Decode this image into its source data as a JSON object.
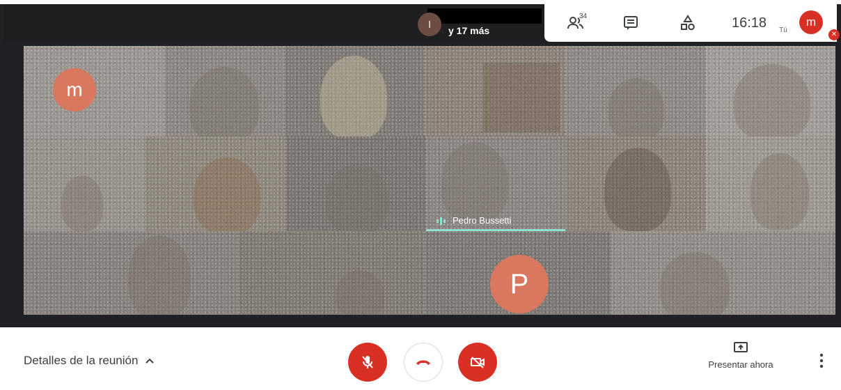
{
  "top_bar": {
    "pinned_avatar_initial": "l",
    "more_participants_label": "y 17 más",
    "people_count": "34",
    "time": "16:18",
    "you_label": "Tú",
    "self_avatar_initial": "m"
  },
  "grid": {
    "tile_m_initial": "m",
    "speaker_name": "Pedro Bussetti",
    "tile_p_initial": "P"
  },
  "controls": {
    "details_label": "Detalles de la reunión",
    "present_label": "Presentar ahora"
  },
  "colors": {
    "accent_red": "#d93025",
    "avatar_salmon": "#d9785f",
    "speaker_highlight": "#8ee0d0"
  }
}
